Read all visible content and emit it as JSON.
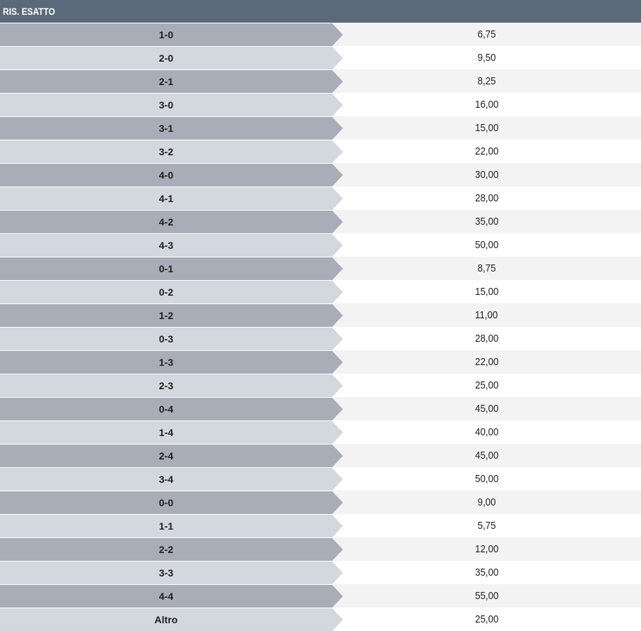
{
  "market": {
    "title": "RIS. ESATTO"
  },
  "outcomes": [
    {
      "score": "1-0",
      "odd": "6,75"
    },
    {
      "score": "2-0",
      "odd": "9,50"
    },
    {
      "score": "2-1",
      "odd": "8,25"
    },
    {
      "score": "3-0",
      "odd": "16,00"
    },
    {
      "score": "3-1",
      "odd": "15,00"
    },
    {
      "score": "3-2",
      "odd": "22,00"
    },
    {
      "score": "4-0",
      "odd": "30,00"
    },
    {
      "score": "4-1",
      "odd": "28,00"
    },
    {
      "score": "4-2",
      "odd": "35,00"
    },
    {
      "score": "4-3",
      "odd": "50,00"
    },
    {
      "score": "0-1",
      "odd": "8,75"
    },
    {
      "score": "0-2",
      "odd": "15,00"
    },
    {
      "score": "1-2",
      "odd": "11,00"
    },
    {
      "score": "0-3",
      "odd": "28,00"
    },
    {
      "score": "1-3",
      "odd": "22,00"
    },
    {
      "score": "2-3",
      "odd": "25,00"
    },
    {
      "score": "0-4",
      "odd": "45,00"
    },
    {
      "score": "1-4",
      "odd": "40,00"
    },
    {
      "score": "2-4",
      "odd": "45,00"
    },
    {
      "score": "3-4",
      "odd": "50,00"
    },
    {
      "score": "0-0",
      "odd": "9,00"
    },
    {
      "score": "1-1",
      "odd": "5,75"
    },
    {
      "score": "2-2",
      "odd": "12,00"
    },
    {
      "score": "3-3",
      "odd": "35,00"
    },
    {
      "score": "4-4",
      "odd": "55,00"
    },
    {
      "score": "Altro",
      "odd": "25,00"
    }
  ],
  "colors": {
    "header_bg": "#5a6a7a",
    "label_dark": "#a9adb8",
    "label_light": "#d3d7de",
    "odd_dark_row": "#f3f3f3",
    "odd_light_row": "#ffffff"
  }
}
